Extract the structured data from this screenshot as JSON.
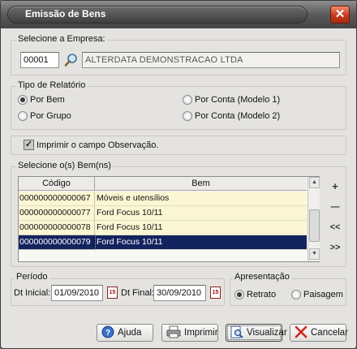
{
  "window": {
    "title": "Emissão de Bens"
  },
  "empresa": {
    "label": "Selecione a Empresa:",
    "code": "00001",
    "name": "ALTERDATA DEMONSTRACAO LTDA"
  },
  "tipo_relatorio": {
    "label": "Tipo de Relatório",
    "options": [
      {
        "label": "Por Bem",
        "selected": true
      },
      {
        "label": "Por Grupo",
        "selected": false
      },
      {
        "label": "Por Conta (Modelo 1)",
        "selected": false
      },
      {
        "label": "Por Conta (Modelo 2)",
        "selected": false
      }
    ]
  },
  "observacao": {
    "label": "Imprimir o campo Observação.",
    "checked": true
  },
  "bens": {
    "label": "Selecione o(s) Bem(ns)",
    "columns": [
      "Código",
      "Bem"
    ],
    "rows": [
      {
        "codigo": "000000000000067",
        "bem": "Móveis e utensílios"
      },
      {
        "codigo": "000000000000077",
        "bem": "Ford Focus 10/11"
      },
      {
        "codigo": "000000000000078",
        "bem": "Ford Focus 10/11"
      },
      {
        "codigo": "000000000000079",
        "bem": "Ford Focus 10/11"
      }
    ],
    "selected_row": 3,
    "side_buttons": [
      "+",
      "—",
      "<<",
      ">>"
    ]
  },
  "periodo": {
    "label": "Período",
    "dt_inicial_label": "Dt Inicial:",
    "dt_inicial": "01/09/2010",
    "dt_final_label": "Dt Final:",
    "dt_final": "30/09/2010",
    "calendar_glyph": "15"
  },
  "apresentacao": {
    "label": "Apresentação",
    "options": [
      {
        "label": "Retrato",
        "selected": true
      },
      {
        "label": "Paisagem",
        "selected": false
      }
    ]
  },
  "buttons": {
    "ajuda": "Ajuda",
    "imprimir": "Imprimir",
    "visualizar": "Visualizar",
    "cancelar": "Cancelar"
  },
  "colors": {
    "selection": "#13235e",
    "row_bg": "#fbf6d4",
    "close": "#c8391c"
  }
}
